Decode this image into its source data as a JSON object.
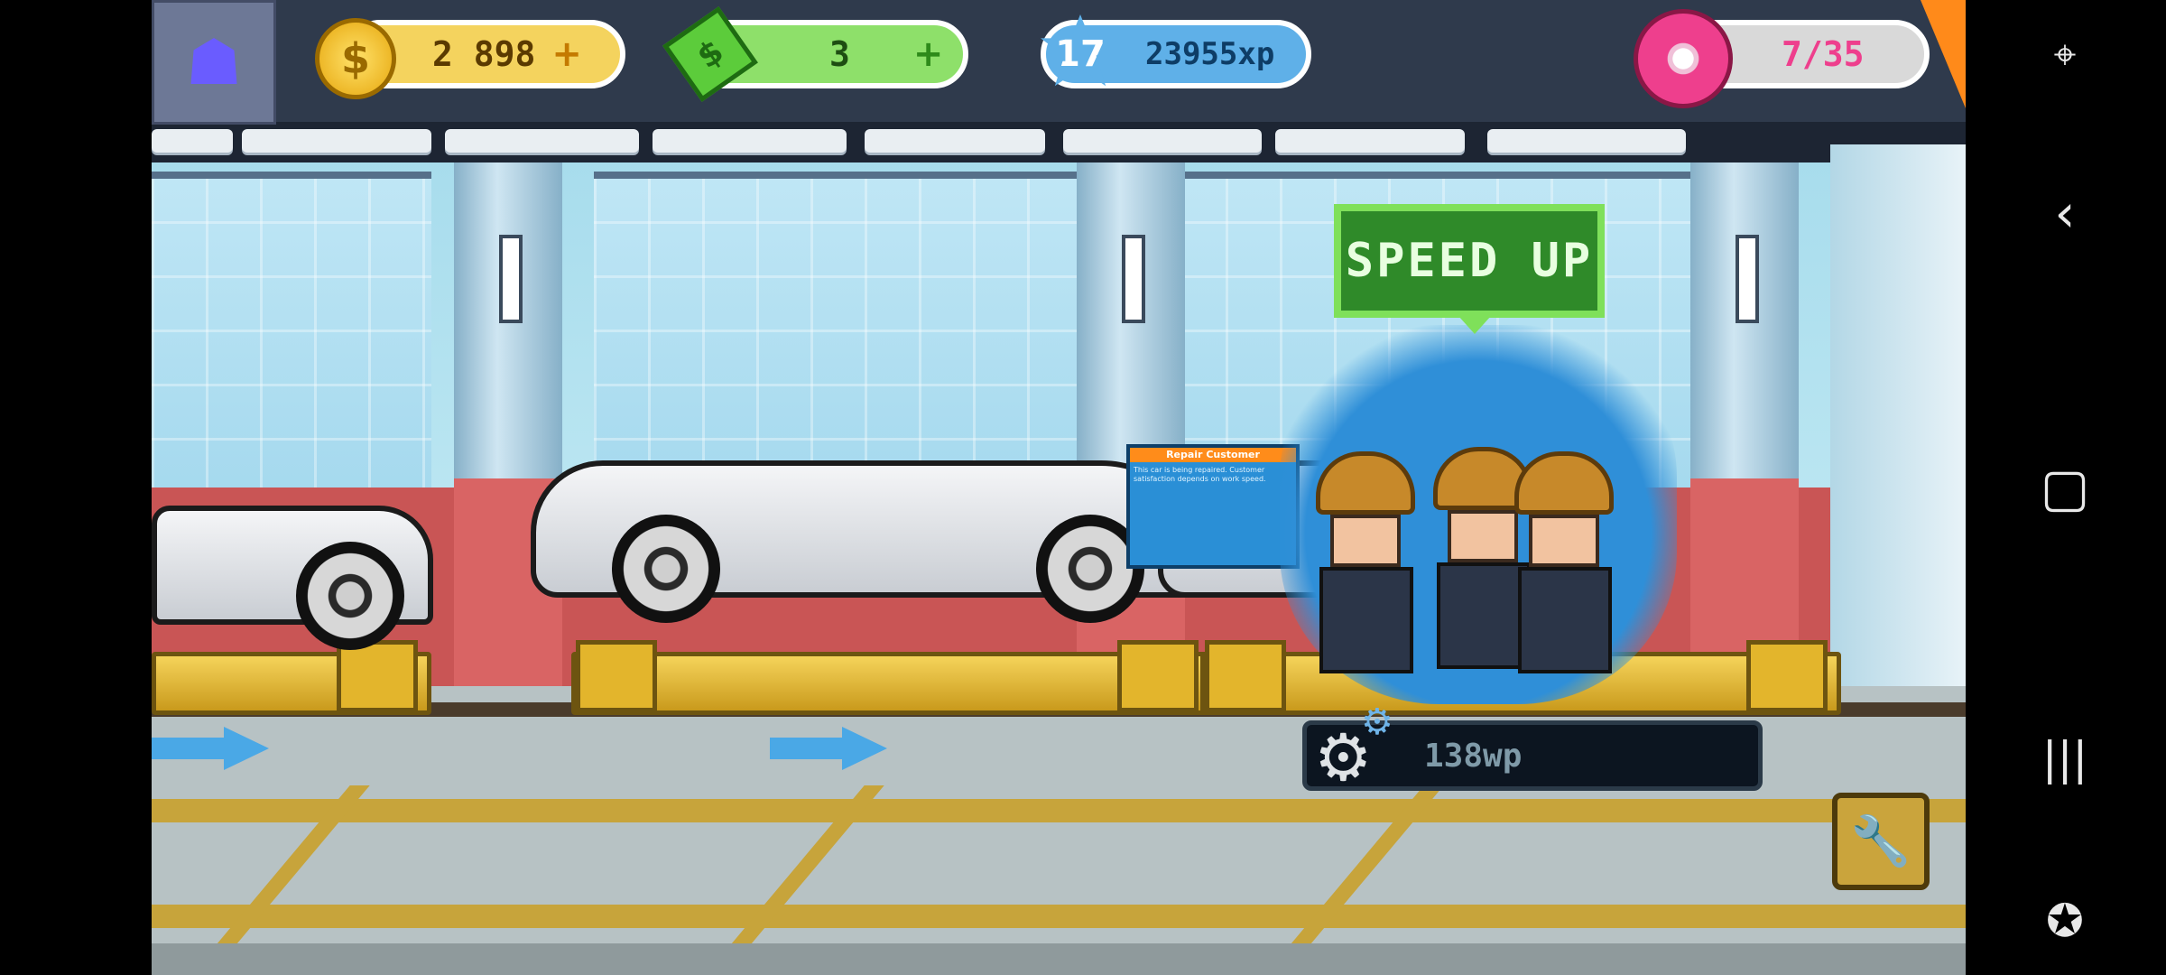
{
  "hud": {
    "coins": "2 898",
    "cash": "3",
    "level": "17",
    "xp": "23955xp",
    "donuts": "7/35",
    "plus": "+"
  },
  "speed_up_label": "SPEED UP",
  "work_points": "138wp",
  "tooltip": {
    "title": "Repair Customer",
    "body": "This car is being repaired. Customer satisfaction depends on work speed."
  },
  "icons": {
    "coin": "$",
    "level_star": "star-icon",
    "wrench": "wrench-icon",
    "gear": "gear-icon"
  },
  "nav": {
    "cursor": "cursor-icon",
    "back": "back-icon",
    "home": "home-icon",
    "recents": "recents-icon",
    "game": "gamepad-icon"
  },
  "colors": {
    "coin_pill": "#f4d35e",
    "cash_pill": "#7fd85a",
    "xp_pill": "#5fb0e8",
    "donut_pill": "#d9d9d9",
    "speed_up": "#2f8a29"
  }
}
